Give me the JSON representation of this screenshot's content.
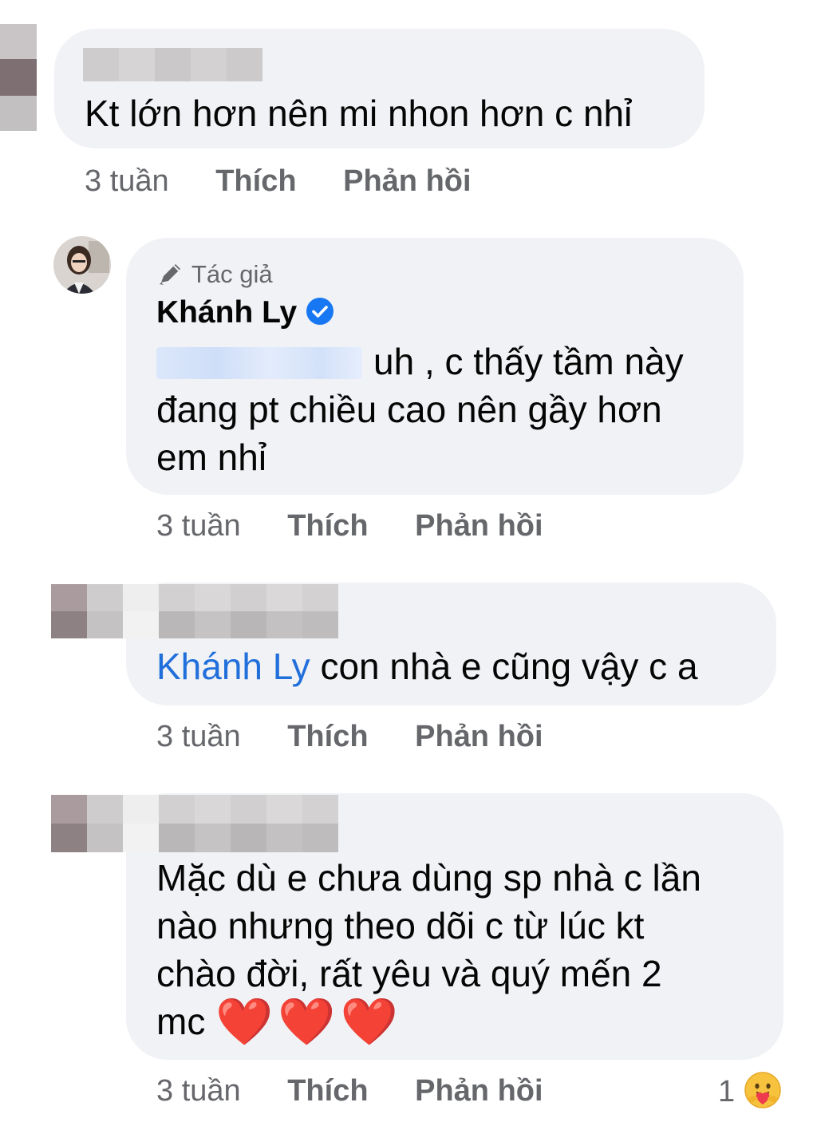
{
  "comments": [
    {
      "author": "",
      "text": "Kt lớn hơn nên mi nhon hơn c nhỉ",
      "time": "3 tuần",
      "like": "Thích",
      "reply": "Phản hồi"
    },
    {
      "badge": "Tác giả",
      "author": "Khánh Ly",
      "text": "uh , c thấy tầm này đang pt chiều cao nên gầy hơn em nhỉ",
      "line1": "uh , c thấy tầm này",
      "line2": "đang pt chiều cao nên gầy hơn",
      "line3": "em nhỉ",
      "time": "3 tuần",
      "like": "Thích",
      "reply": "Phản hồi"
    },
    {
      "author": "",
      "mention": "Khánh Ly",
      "text": "con nhà e cũng vậy c a",
      "time": "3 tuần",
      "like": "Thích",
      "reply": "Phản hồi"
    },
    {
      "author": "",
      "line1": "Mặc dù e chưa dùng sp nhà c lần",
      "line2": "nào nhưng theo dõi c từ lúc kt",
      "line3": "chào đời, rất yêu và quý mến 2",
      "line4": "mc",
      "emoji": "❤️❤️❤️",
      "time": "3 tuần",
      "like": "Thích",
      "reply": "Phản hồi",
      "reaction_count": "1",
      "reaction_icon": "care-emoji-icon"
    }
  ],
  "colors": {
    "bubble": "#f0f2f5",
    "meta": "#65676b",
    "link": "#216fdb",
    "verified": "#1877f2",
    "heart": "#e0202c"
  }
}
